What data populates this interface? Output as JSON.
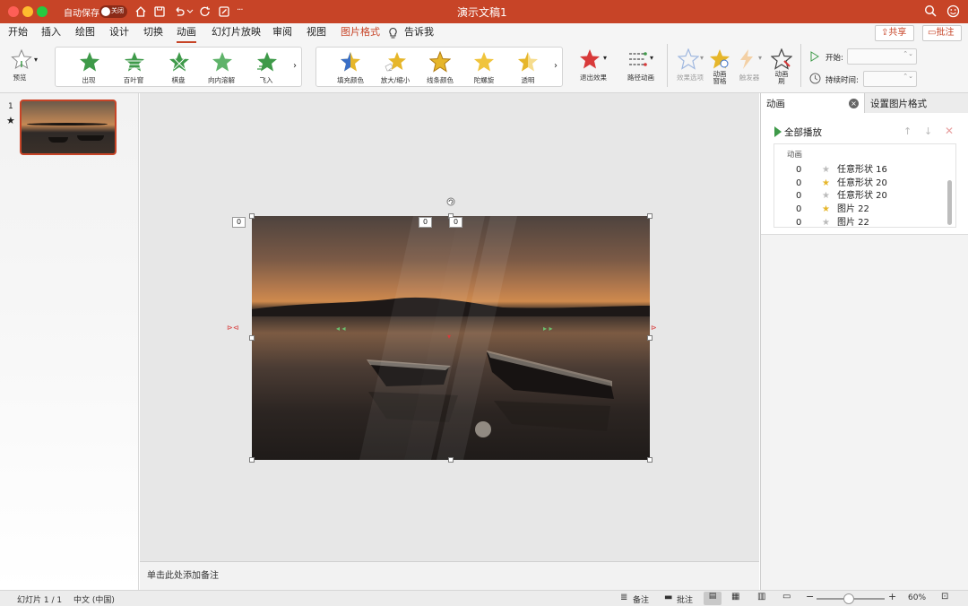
{
  "window": {
    "title": "演示文稿1",
    "autosave_label": "自动保存",
    "autosave_state": "关闭"
  },
  "tabs": [
    "开始",
    "插入",
    "绘图",
    "设计",
    "切换",
    "动画",
    "幻灯片放映",
    "审阅",
    "视图",
    "图片格式",
    "告诉我"
  ],
  "active_tab": "动画",
  "header_buttons": {
    "share": "共享",
    "comment": "批注"
  },
  "ribbon": {
    "preview": "预览",
    "entrance_effects": [
      "出现",
      "百叶窗",
      "棋盘",
      "向内溶解",
      "飞入"
    ],
    "emphasis_effects": [
      "填充颜色",
      "放大/缩小",
      "线条颜色",
      "陀螺旋",
      "透明"
    ],
    "exit": "退出效果",
    "path": "路径动画",
    "effect_options": "效果选项",
    "pane": "动画\n窗格",
    "trigger": "触发器",
    "brush": "动画\n刷",
    "start_label": "开始:",
    "duration_label": "持续时间:"
  },
  "slides": {
    "number": "1"
  },
  "notes_placeholder": "单击此处添加备注",
  "pane": {
    "tab_animation": "动画",
    "tab_format": "设置图片格式",
    "play_all": "全部播放",
    "list_header": "动画",
    "items": [
      {
        "order": "0",
        "name": "任意形状 16",
        "icon": "sparkle-star-icon"
      },
      {
        "order": "0",
        "name": "任意形状 20",
        "icon": "gold-star-icon"
      },
      {
        "order": "0",
        "name": "任意形状 20",
        "icon": "sparkle-star-icon"
      },
      {
        "order": "0",
        "name": "图片 22",
        "icon": "gold-star-icon"
      },
      {
        "order": "0",
        "name": "图片 22",
        "icon": "sparkle-star-icon"
      }
    ]
  },
  "canvas_badges": [
    "0",
    "0",
    "0"
  ],
  "status": {
    "slide": "幻灯片 1 / 1",
    "lang": "中文 (中国)",
    "notes": "备注",
    "comments": "批注",
    "zoom": "60%"
  },
  "zoom_level": 0.6,
  "colors": {
    "accent": "#c74427",
    "entrance": "#3e9a49",
    "emphasis": "#e6b62a",
    "exit": "#d83a3a"
  }
}
